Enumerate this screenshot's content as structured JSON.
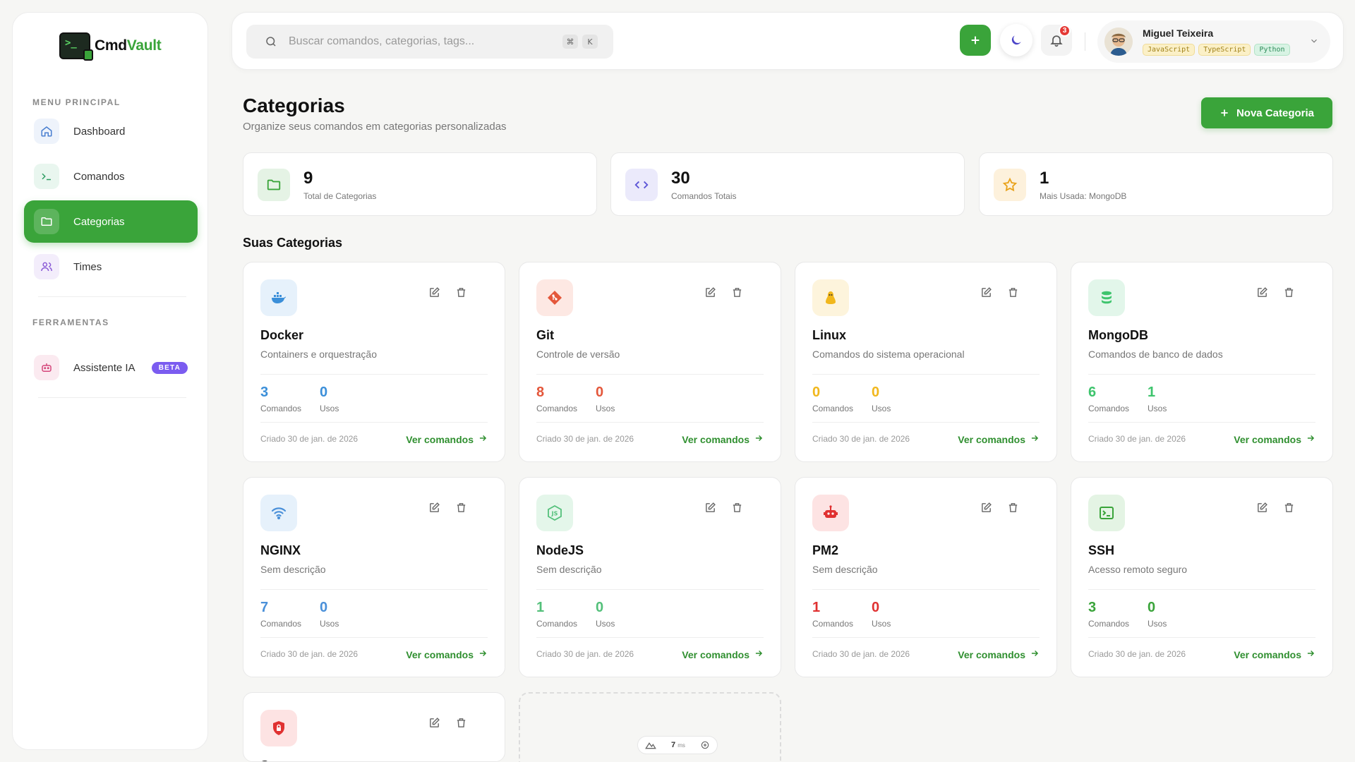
{
  "app": {
    "name_a": "Cmd",
    "name_b": "Vault"
  },
  "sidebar": {
    "menu_label": "MENU PRINCIPAL",
    "items": [
      {
        "label": "Dashboard",
        "icon": "home-icon"
      },
      {
        "label": "Comandos",
        "icon": "terminal-icon"
      },
      {
        "label": "Categorias",
        "icon": "folder-icon",
        "active": true
      },
      {
        "label": "Times",
        "icon": "users-icon"
      }
    ],
    "tools_label": "FERRAMENTAS",
    "tools": [
      {
        "label": "Assistente IA",
        "icon": "robot-icon",
        "badge": "BETA"
      }
    ]
  },
  "search": {
    "placeholder": "Buscar comandos, categorias, tags...",
    "kbd1": "⌘",
    "kbd2": "K"
  },
  "notifications": {
    "count": "3"
  },
  "user": {
    "name": "Miguel Teixeira",
    "tags": [
      "JavaScript",
      "TypeScript",
      "Python"
    ]
  },
  "header": {
    "title": "Categorias",
    "subtitle": "Organize seus comandos em categorias personalizadas",
    "new_button": "Nova Categoria"
  },
  "stats": [
    {
      "value": "9",
      "label": "Total de Categorias"
    },
    {
      "value": "30",
      "label": "Comandos Totais"
    },
    {
      "value": "1",
      "label": "Mais Usada: MongoDB"
    }
  ],
  "section_title": "Suas Categorias",
  "labels": {
    "commands": "Comandos",
    "uses": "Usos",
    "view": "Ver comandos"
  },
  "categories": [
    {
      "name": "Docker",
      "desc": "Containers e orquestração",
      "commands": "3",
      "uses": "0",
      "created": "Criado 30 de jan. de 2026",
      "color": "#3b8fd9",
      "bg": "#e6f1fb",
      "icon": "docker-icon"
    },
    {
      "name": "Git",
      "desc": "Controle de versão",
      "commands": "8",
      "uses": "0",
      "created": "Criado 30 de jan. de 2026",
      "color": "#e4573b",
      "bg": "#fde8e3",
      "icon": "git-icon"
    },
    {
      "name": "Linux",
      "desc": "Comandos do sistema operacional",
      "commands": "0",
      "uses": "0",
      "created": "Criado 30 de jan. de 2026",
      "color": "#f1b71c",
      "bg": "#fdf4dc",
      "icon": "linux-icon"
    },
    {
      "name": "MongoDB",
      "desc": "Comandos de banco de dados",
      "commands": "6",
      "uses": "1",
      "created": "Criado 30 de jan. de 2026",
      "color": "#3ec46d",
      "bg": "#e2f6ea",
      "icon": "database-icon"
    },
    {
      "name": "NGINX",
      "desc": "Sem descrição",
      "commands": "7",
      "uses": "0",
      "created": "Criado 30 de jan. de 2026",
      "color": "#4a90d9",
      "bg": "#e6f1fb",
      "icon": "wifi-icon"
    },
    {
      "name": "NodeJS",
      "desc": "Sem descrição",
      "commands": "1",
      "uses": "0",
      "created": "Criado 30 de jan. de 2026",
      "color": "#53c07a",
      "bg": "#e4f6ea",
      "icon": "nodejs-icon"
    },
    {
      "name": "PM2",
      "desc": "Sem descrição",
      "commands": "1",
      "uses": "0",
      "created": "Criado 30 de jan. de 2026",
      "color": "#e03131",
      "bg": "#fde3e3",
      "icon": "robot-icon"
    },
    {
      "name": "SSH",
      "desc": "Acesso remoto seguro",
      "commands": "3",
      "uses": "0",
      "created": "Criado 30 de jan. de 2026",
      "color": "#3aa43a",
      "bg": "#e4f4e4",
      "icon": "terminal-icon"
    },
    {
      "name": "S",
      "desc": "",
      "commands": "",
      "uses": "",
      "created": "",
      "color": "#e03131",
      "bg": "#fde3e3",
      "icon": "shield-lock-icon"
    }
  ],
  "perf": {
    "value": "7",
    "unit": "ms"
  }
}
